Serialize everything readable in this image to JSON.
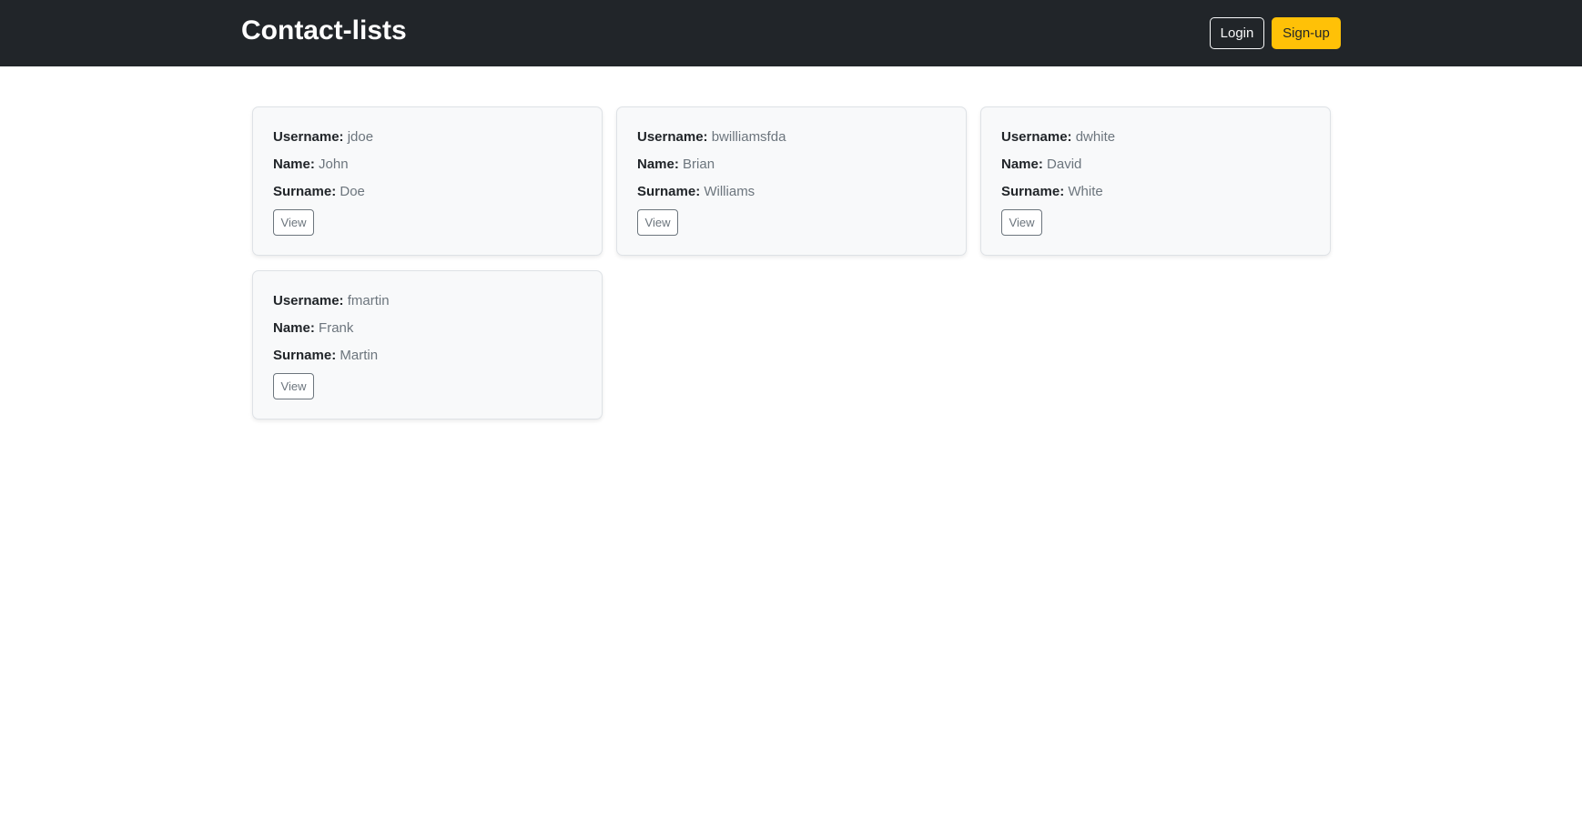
{
  "navbar": {
    "brand": "Contact-lists",
    "login_label": "Login",
    "signup_label": "Sign-up"
  },
  "labels": {
    "username": "Username:",
    "name": "Name:",
    "surname": "Surname:"
  },
  "contacts": [
    {
      "username": "jdoe",
      "name": "John",
      "surname": "Doe",
      "view_label": "View"
    },
    {
      "username": "bwilliamsfda",
      "name": "Brian",
      "surname": "Williams",
      "view_label": "View"
    },
    {
      "username": "dwhite",
      "name": "David",
      "surname": "White",
      "view_label": "View"
    },
    {
      "username": "fmartin",
      "name": "Frank",
      "surname": "Martin",
      "view_label": "View"
    }
  ],
  "colors": {
    "navbar_bg": "#212529",
    "signup_accent": "#ffc107",
    "card_bg": "#f8f9fa",
    "muted_text": "#6c757d"
  }
}
